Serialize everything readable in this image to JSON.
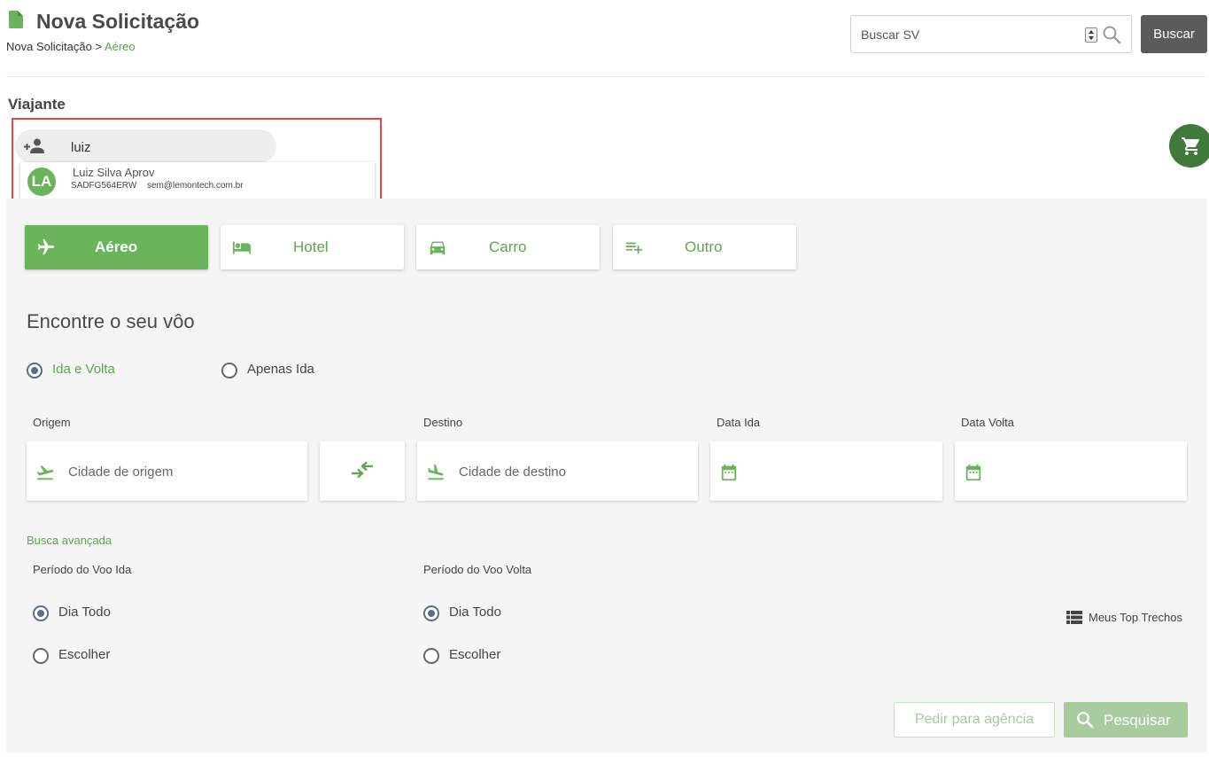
{
  "header": {
    "title": "Nova Solicitação",
    "breadcrumb": {
      "root": "Nova Solicitação",
      "separator": " > ",
      "current": "Aéreo"
    },
    "search": {
      "placeholder": "Buscar SV",
      "button_label": "Buscar"
    }
  },
  "traveler": {
    "section_label": "Viajante",
    "input_value": "luiz",
    "suggestion": {
      "initials": "LA",
      "name": "Luiz Silva Aprov",
      "code": "SADFG564ERW",
      "email": "sem@lemontech.com.br"
    }
  },
  "type_tabs": [
    {
      "label": "Aéreo",
      "icon": "airplane-icon",
      "active": true
    },
    {
      "label": "Hotel",
      "icon": "hotel-bed-icon",
      "active": false
    },
    {
      "label": "Carro",
      "icon": "car-icon",
      "active": false
    },
    {
      "label": "Outro",
      "icon": "playlist-add-icon",
      "active": false
    }
  ],
  "flight": {
    "title": "Encontre o seu vôo",
    "trip_type": {
      "round_trip": "Ida e Volta",
      "one_way": "Apenas Ida",
      "selected": "round_trip"
    },
    "fields": {
      "origin_label": "Origem",
      "origin_placeholder": "Cidade de origem",
      "destination_label": "Destino",
      "destination_placeholder": "Cidade de destino",
      "depart_label": "Data Ida",
      "return_label": "Data Volta"
    },
    "advanced_link": "Busca avançada",
    "period_outbound": {
      "label": "Período do Voo Ida",
      "all_day": "Dia Todo",
      "choose": "Escolher",
      "selected": "all_day"
    },
    "period_return": {
      "label": "Período do Voo Volta",
      "all_day": "Dia Todo",
      "choose": "Escolher",
      "selected": "all_day"
    },
    "top_trechos": "Meus Top Trechos",
    "agency_button": "Pedir para agência",
    "search_button": "Pesquisar"
  },
  "colors": {
    "brand_green": "#6ab45c",
    "text_green": "#5ea64f",
    "cart_green": "#3f7a3a",
    "dark_button": "#5b5b5b",
    "highlight_red": "#e0454a"
  }
}
